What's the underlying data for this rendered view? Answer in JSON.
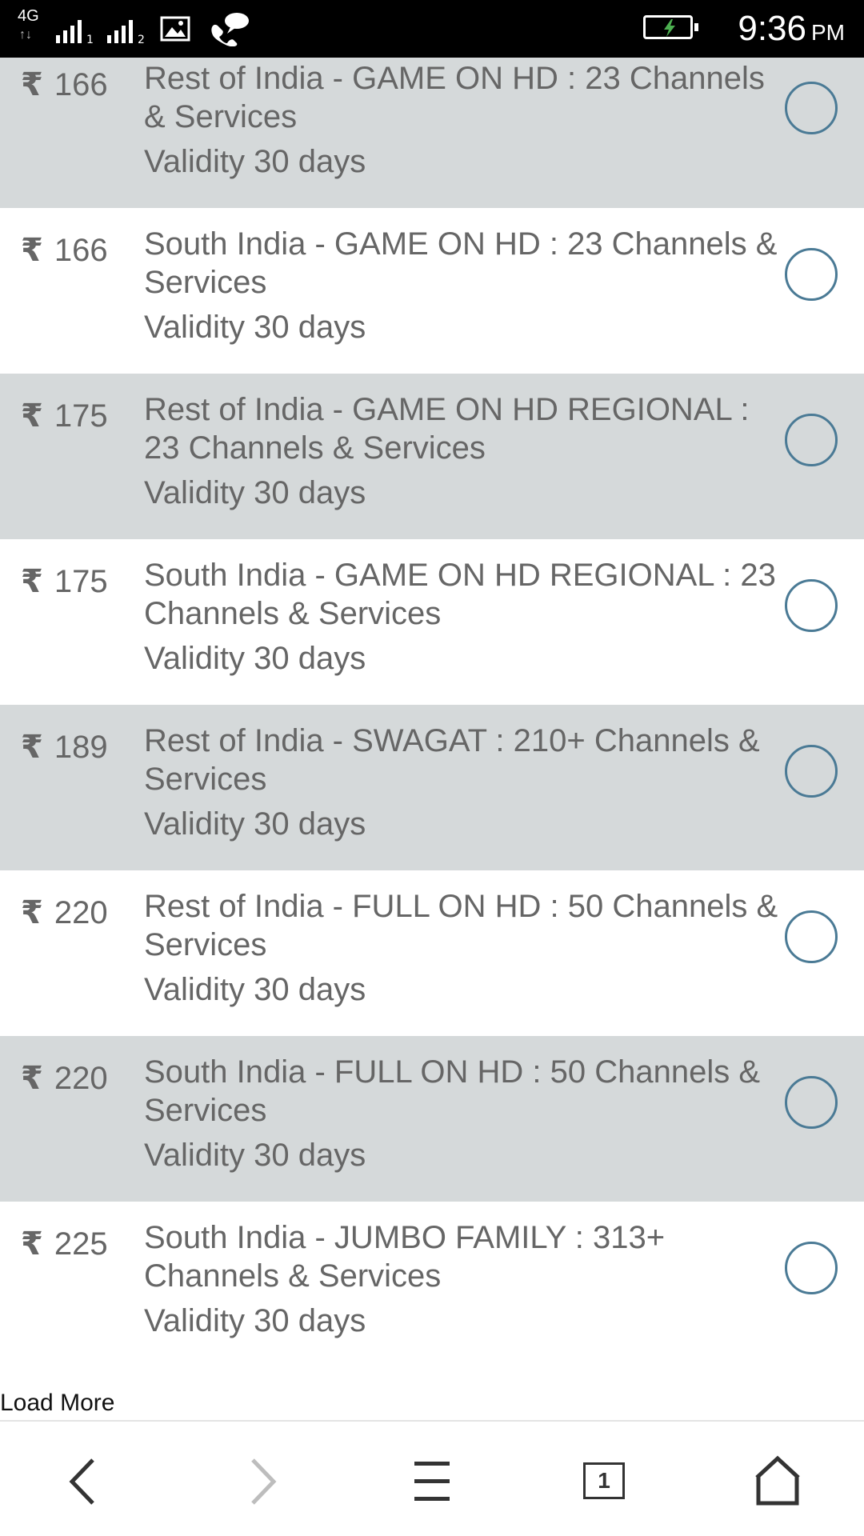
{
  "status_bar": {
    "network_type": "4G",
    "sim1_index": "1",
    "sim2_index": "2",
    "icons": [
      "signal-sim1-icon",
      "signal-sim2-icon",
      "gallery-icon",
      "message-icon",
      "battery-charging-icon"
    ],
    "time": "9:36",
    "ampm": "PM"
  },
  "currency_symbol": "₹",
  "plans": [
    {
      "price": "166",
      "title": "Rest of India - GAME ON HD : 23 Channels & Services",
      "validity": "Validity 30 days"
    },
    {
      "price": "166",
      "title": "South India - GAME ON HD : 23 Channels & Services",
      "validity": "Validity 30 days"
    },
    {
      "price": "175",
      "title": "Rest of India - GAME ON HD REGIONAL : 23 Channels & Services",
      "validity": "Validity 30 days"
    },
    {
      "price": "175",
      "title": "South India - GAME ON HD REGIONAL : 23 Channels & Services",
      "validity": "Validity 30 days"
    },
    {
      "price": "189",
      "title": "Rest of India - SWAGAT : 210+ Channels & Services",
      "validity": "Validity 30 days"
    },
    {
      "price": "220",
      "title": "Rest of India - FULL ON HD : 50 Channels & Services",
      "validity": "Validity 30 days"
    },
    {
      "price": "220",
      "title": "South India - FULL ON HD : 50 Channels & Services",
      "validity": "Validity 30 days"
    },
    {
      "price": "225",
      "title": "South India - JUMBO FAMILY : 313+ Channels & Services",
      "validity": "Validity 30 days"
    }
  ],
  "load_more_label": "Load More",
  "bottom_nav": {
    "tab_count": "1",
    "icons": [
      "back-icon",
      "forward-icon",
      "menu-icon",
      "tabs-icon",
      "home-icon"
    ]
  },
  "colors": {
    "status_bar_bg": "#000000",
    "row_alt_bg": "#d5d9da",
    "row_bg": "#ffffff",
    "text": "#666666",
    "radio_border": "#4a7a95",
    "battery_bolt": "#4caf50",
    "forward_disabled": "#bdbdbd"
  }
}
